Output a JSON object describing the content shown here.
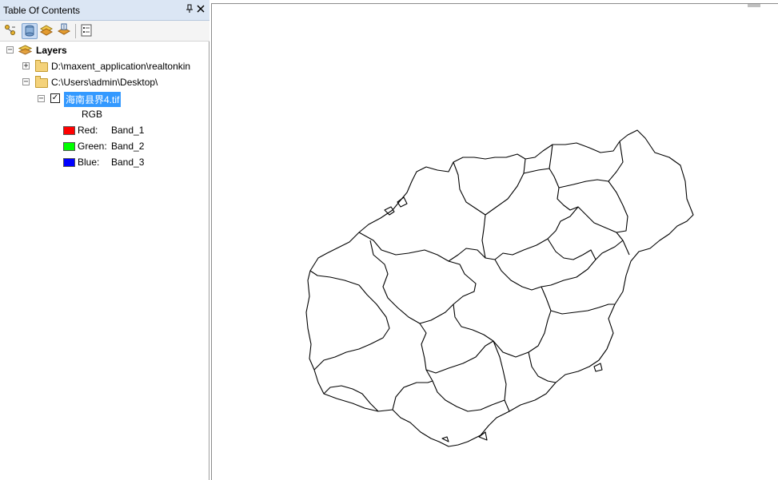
{
  "toc": {
    "title": "Table Of Contents",
    "pin_glyph": "ท",
    "close_glyph": "×",
    "toolbar": [
      {
        "name": "list-by-drawing-order-icon"
      },
      {
        "name": "list-by-source-icon",
        "active": true
      },
      {
        "name": "list-by-visibility-icon"
      },
      {
        "name": "list-by-selection-icon"
      },
      {
        "name": "options-icon"
      }
    ],
    "tree": {
      "root_label": "Layers",
      "folders": [
        {
          "path": "D:\\maxent_application\\realtonkin",
          "expanded": false
        },
        {
          "path": "C:\\Users\\admin\\Desktop\\",
          "expanded": true
        }
      ],
      "layer": {
        "name": "海南县界4.tif",
        "checked": true,
        "render_type": "RGB",
        "bands": [
          {
            "channel": "Red:",
            "band": "Band_1",
            "color": "#ff0000"
          },
          {
            "channel": "Green:",
            "band": "Band_2",
            "color": "#00ff00"
          },
          {
            "channel": "Blue:",
            "band": "Band_3",
            "color": "#0000ff"
          }
        ]
      }
    }
  },
  "colors": {
    "titlebar_bg": "#dbe6f4",
    "selection_bg": "#3399ff",
    "boundary_line": "#000000"
  }
}
